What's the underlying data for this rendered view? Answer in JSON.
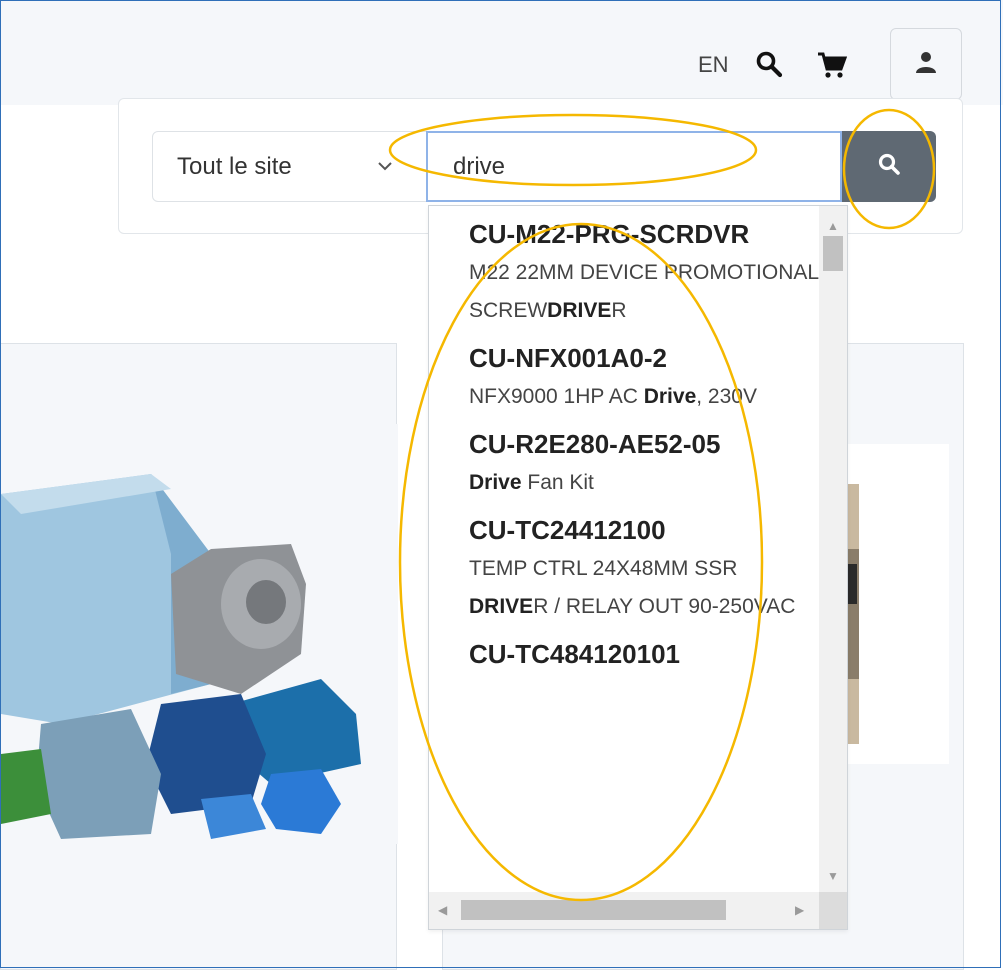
{
  "header": {
    "language": "EN",
    "icons": {
      "search": "search-icon",
      "cart": "cart-icon",
      "account": "user-icon"
    }
  },
  "search": {
    "scope_selected": "Tout le site",
    "query": "drive",
    "submit_icon": "search-icon"
  },
  "results": [
    {
      "sku": "CU-M22-PRG-SCRDVR",
      "desc_parts": [
        [
          "M22 22MM DEVICE PROMOTIONAL SCREW",
          false
        ],
        [
          "DRIVE",
          true
        ],
        [
          "R",
          false
        ]
      ]
    },
    {
      "sku": "CU-NFX001A0-2",
      "desc_parts": [
        [
          "NFX9000 1HP AC ",
          false
        ],
        [
          "Drive",
          true
        ],
        [
          ", 230V",
          false
        ]
      ]
    },
    {
      "sku": "CU-R2E280-AE52-05",
      "desc_parts": [
        [
          "Drive",
          true
        ],
        [
          " Fan Kit",
          false
        ]
      ]
    },
    {
      "sku": "CU-TC24412100",
      "desc_parts": [
        [
          "TEMP CTRL 24X48MM SSR ",
          false
        ],
        [
          "DRIVE",
          true
        ],
        [
          "R / RELAY OUT 90-250VAC",
          false
        ]
      ]
    },
    {
      "sku": "CU-TC484120101",
      "desc_parts": []
    }
  ],
  "colors": {
    "annotation": "#f5b800",
    "submit_button": "#5f6973",
    "input_focus_border": "#8fb3e8"
  }
}
